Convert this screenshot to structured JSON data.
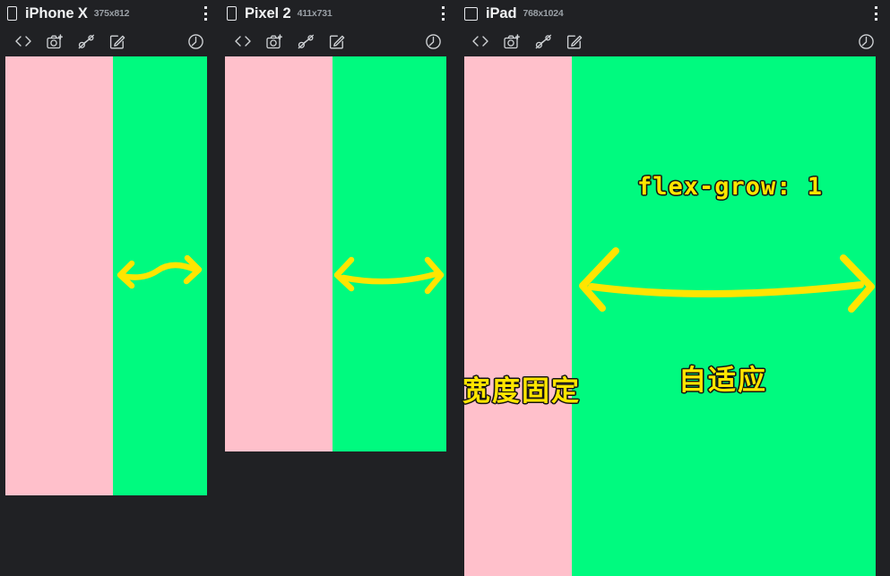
{
  "app": {
    "background_color": "#202124",
    "fixed_pane_color": "#ffc0cb",
    "grow_pane_color": "#00fa7f",
    "annotation_color": "#ffe500"
  },
  "devices": [
    {
      "name": "iPhone X",
      "dimensions": "375x812",
      "device_glyph": "phone-icon",
      "menu_label": "more-options",
      "toolbar": [
        {
          "icon": "code-brackets-icon",
          "label": "<>"
        },
        {
          "icon": "camera-screenshot-icon",
          "label": "Capture screenshot"
        },
        {
          "icon": "inspect-ruler-icon",
          "label": "Inspect"
        },
        {
          "icon": "edit-square-icon",
          "label": "Edit"
        },
        {
          "icon": "rotate-refresh-icon",
          "label": "Rotate"
        }
      ]
    },
    {
      "name": "Pixel 2",
      "dimensions": "411x731",
      "device_glyph": "phone-icon",
      "menu_label": "more-options",
      "toolbar": [
        {
          "icon": "code-brackets-icon",
          "label": "<>"
        },
        {
          "icon": "camera-screenshot-icon",
          "label": "Capture screenshot"
        },
        {
          "icon": "inspect-ruler-icon",
          "label": "Inspect"
        },
        {
          "icon": "edit-square-icon",
          "label": "Edit"
        },
        {
          "icon": "rotate-refresh-icon",
          "label": "Rotate"
        }
      ]
    },
    {
      "name": "iPad",
      "dimensions": "768x1024",
      "device_glyph": "tablet-icon",
      "menu_label": "more-options",
      "toolbar": [
        {
          "icon": "code-brackets-icon",
          "label": "<>"
        },
        {
          "icon": "camera-screenshot-icon",
          "label": "Capture screenshot"
        },
        {
          "icon": "inspect-ruler-icon",
          "label": "Inspect"
        },
        {
          "icon": "edit-square-icon",
          "label": "Edit"
        },
        {
          "icon": "rotate-refresh-icon",
          "label": "Rotate"
        }
      ]
    }
  ],
  "annotations": {
    "flex_grow": "flex-grow: 1",
    "fixed_width": "宽度固定",
    "adaptive": "自适应"
  }
}
